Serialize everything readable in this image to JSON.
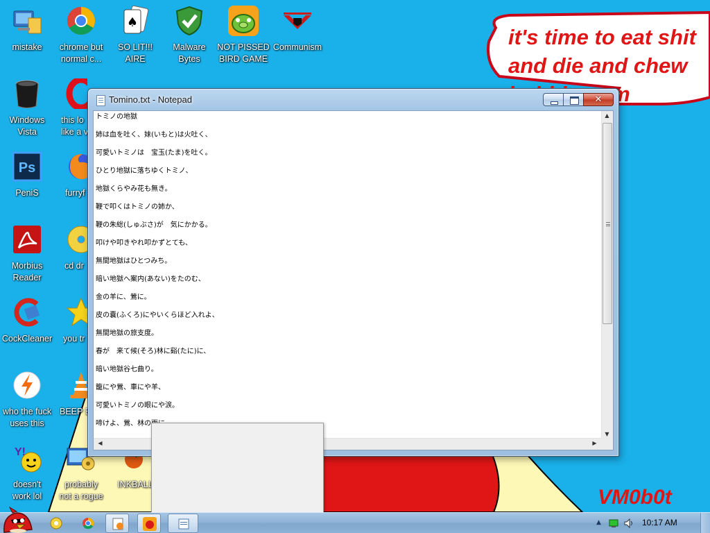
{
  "wallpaper": {
    "speech_text": "it's time to eat shit\nand die and chew\nbubble gum",
    "signature": "VM0b0t"
  },
  "desktop_icons": [
    {
      "id": "mistake",
      "label": "mistake",
      "icon": "computer-folder-icon"
    },
    {
      "id": "chrome",
      "label": "chrome but\nnormal c...",
      "icon": "chrome-icon"
    },
    {
      "id": "solitaire",
      "label": "SO LIT!!!\nAIRE",
      "icon": "solitaire-cards-icon"
    },
    {
      "id": "malwarebytes",
      "label": "Malware\nBytes",
      "icon": "shield-check-icon"
    },
    {
      "id": "angrybirds",
      "label": "NOT PISSED\nBIRD GAME",
      "icon": "green-pig-icon"
    },
    {
      "id": "communism",
      "label": "Communism",
      "icon": "communism-emblem-icon"
    },
    {
      "id": "windows-vista",
      "label": "Windows\nVista",
      "icon": "recycle-bin-icon"
    },
    {
      "id": "opera",
      "label": "this lo\nlike a v",
      "icon": "opera-icon"
    },
    {
      "id": "photoshop",
      "label": "PeniS",
      "icon": "photoshop-icon"
    },
    {
      "id": "firefox",
      "label": "furryf",
      "icon": "firefox-icon"
    },
    {
      "id": "morbius",
      "label": "Morbius\nReader",
      "icon": "acrobat-reader-icon"
    },
    {
      "id": "cd-drive",
      "label": "cd dr",
      "icon": "cd-disc-icon"
    },
    {
      "id": "ccleaner",
      "label": "CockCleaner",
      "icon": "ccleaner-icon"
    },
    {
      "id": "star",
      "label": "you tr",
      "icon": "star-icon"
    },
    {
      "id": "avast",
      "label": "who the fuck\nuses this",
      "icon": "lightning-orb-icon"
    },
    {
      "id": "vlc",
      "label": "BEEP B",
      "icon": "vlc-cone-icon"
    },
    {
      "id": "yahoo",
      "label": "doesn't\nwork lol",
      "icon": "yahoo-smiley-icon"
    },
    {
      "id": "rogue",
      "label": "probably\nnot a rogue",
      "icon": "computer-gears-icon"
    },
    {
      "id": "inkball",
      "label": "INKBALL",
      "icon": "inkball-icon"
    }
  ],
  "notepad": {
    "title": "Tomino.txt - Notepad",
    "close_glyph": "✕",
    "lines": [
      "トミノの地獄",
      "姉は血を吐く、妹(いもと)は火吐く、",
      "可愛いトミノは　宝玉(たま)を吐く。",
      "ひとり地獄に落ちゆくトミノ、",
      "地獄くらやみ花も無き。",
      "鞭で叩くはトミノの姉か、",
      "鞭の朱総(しゅぶさ)が　気にかかる。",
      "叩けや叩きやれ叩かずとても、",
      "無間地獄はひとつみち。",
      "暗い地獄へ案内(あない)をたのむ、",
      "金の羊に、鶯に。",
      "皮の嚢(ふくろ)にやいくらほど入れよ、",
      "無間地獄の旅支度。",
      "春が　来て候(そろ)林に谿(たに)に、",
      "暗い地獄谷七曲り。",
      "籠にや鶯、車にや羊、",
      "可愛いトミノの眼にや涙。",
      "啼けよ、鶯、林の雨に"
    ],
    "scroll_up": "▲",
    "scroll_down": "▼",
    "scroll_left": "◀",
    "scroll_right": "▶"
  },
  "taskbar": {
    "pinned": [
      {
        "id": "start",
        "icon": "angry-bird-start-orb-icon"
      },
      {
        "id": "explorer",
        "icon": "folder-icon"
      },
      {
        "id": "chrome",
        "icon": "chrome-icon"
      },
      {
        "id": "media",
        "icon": "media-player-icon"
      },
      {
        "id": "bird-game",
        "icon": "angry-bird-icon"
      },
      {
        "id": "notepad",
        "icon": "notepad-icon"
      }
    ],
    "tray_arrow": "▲",
    "clock": "10:17 AM"
  },
  "colors": {
    "desktop_bg": "#1ab0ea",
    "wall_red": "#e01616",
    "wall_yellow": "#fef8b6"
  }
}
